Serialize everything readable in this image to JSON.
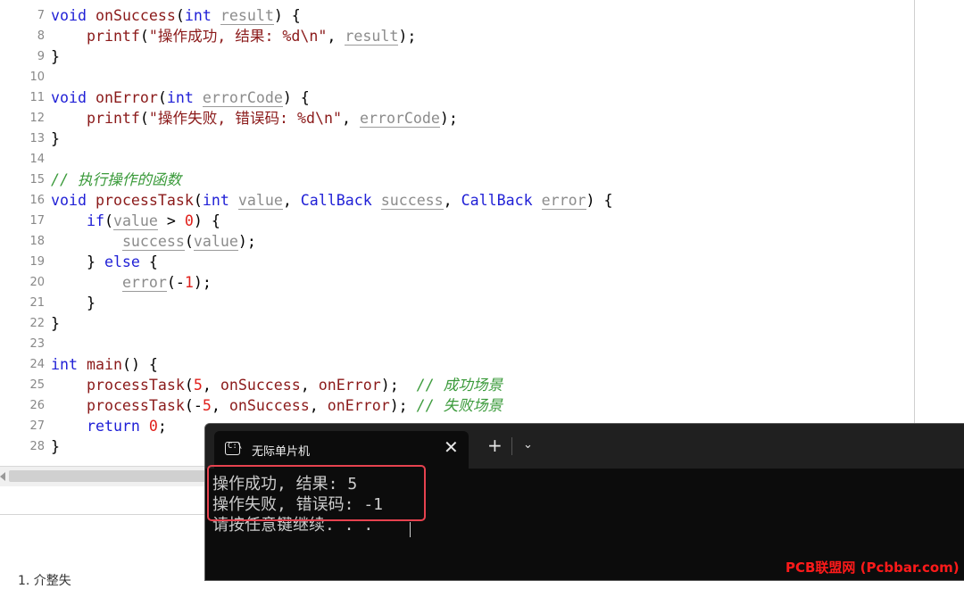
{
  "editor": {
    "lines": [
      {
        "n": "7",
        "tokens": [
          {
            "t": "void",
            "c": "kw"
          },
          {
            "t": " "
          },
          {
            "t": "onSuccess",
            "c": "fn"
          },
          {
            "t": "("
          },
          {
            "t": "int",
            "c": "kw"
          },
          {
            "t": " "
          },
          {
            "t": "result",
            "c": "param"
          },
          {
            "t": ") {"
          }
        ]
      },
      {
        "n": "8",
        "tokens": [
          {
            "t": "    "
          },
          {
            "t": "printf",
            "c": "fn"
          },
          {
            "t": "("
          },
          {
            "t": "\"操作成功, 结果: %d\\n\"",
            "c": "str"
          },
          {
            "t": ", "
          },
          {
            "t": "result",
            "c": "param"
          },
          {
            "t": ");"
          }
        ]
      },
      {
        "n": "9",
        "tokens": [
          {
            "t": "}"
          }
        ]
      },
      {
        "n": "10",
        "tokens": []
      },
      {
        "n": "11",
        "tokens": [
          {
            "t": "void",
            "c": "kw"
          },
          {
            "t": " "
          },
          {
            "t": "onError",
            "c": "fn"
          },
          {
            "t": "("
          },
          {
            "t": "int",
            "c": "kw"
          },
          {
            "t": " "
          },
          {
            "t": "errorCode",
            "c": "param"
          },
          {
            "t": ") {"
          }
        ]
      },
      {
        "n": "12",
        "tokens": [
          {
            "t": "    "
          },
          {
            "t": "printf",
            "c": "fn"
          },
          {
            "t": "("
          },
          {
            "t": "\"操作失败, 错误码: %d\\n\"",
            "c": "str"
          },
          {
            "t": ", "
          },
          {
            "t": "errorCode",
            "c": "param"
          },
          {
            "t": ");"
          }
        ]
      },
      {
        "n": "13",
        "tokens": [
          {
            "t": "}"
          }
        ]
      },
      {
        "n": "14",
        "tokens": []
      },
      {
        "n": "15",
        "tokens": [
          {
            "t": "// 执行操作的函数",
            "c": "cm"
          }
        ]
      },
      {
        "n": "16",
        "tokens": [
          {
            "t": "void",
            "c": "kw"
          },
          {
            "t": " "
          },
          {
            "t": "processTask",
            "c": "fn"
          },
          {
            "t": "("
          },
          {
            "t": "int",
            "c": "kw"
          },
          {
            "t": " "
          },
          {
            "t": "value",
            "c": "param"
          },
          {
            "t": ", "
          },
          {
            "t": "CallBack",
            "c": "ty"
          },
          {
            "t": " "
          },
          {
            "t": "success",
            "c": "param"
          },
          {
            "t": ", "
          },
          {
            "t": "CallBack",
            "c": "ty"
          },
          {
            "t": " "
          },
          {
            "t": "error",
            "c": "param"
          },
          {
            "t": ") {"
          }
        ]
      },
      {
        "n": "17",
        "tokens": [
          {
            "t": "    "
          },
          {
            "t": "if",
            "c": "kw"
          },
          {
            "t": "("
          },
          {
            "t": "value",
            "c": "param"
          },
          {
            "t": " > "
          },
          {
            "t": "0",
            "c": "num"
          },
          {
            "t": ") {"
          }
        ]
      },
      {
        "n": "18",
        "tokens": [
          {
            "t": "        "
          },
          {
            "t": "success",
            "c": "param"
          },
          {
            "t": "("
          },
          {
            "t": "value",
            "c": "param"
          },
          {
            "t": ");"
          }
        ]
      },
      {
        "n": "19",
        "tokens": [
          {
            "t": "    } "
          },
          {
            "t": "else",
            "c": "kw"
          },
          {
            "t": " {"
          }
        ]
      },
      {
        "n": "20",
        "tokens": [
          {
            "t": "        "
          },
          {
            "t": "error",
            "c": "param"
          },
          {
            "t": "(-"
          },
          {
            "t": "1",
            "c": "num"
          },
          {
            "t": ");"
          }
        ]
      },
      {
        "n": "21",
        "tokens": [
          {
            "t": "    }"
          }
        ]
      },
      {
        "n": "22",
        "tokens": [
          {
            "t": "}"
          }
        ]
      },
      {
        "n": "23",
        "tokens": []
      },
      {
        "n": "24",
        "tokens": [
          {
            "t": "int",
            "c": "kw"
          },
          {
            "t": " "
          },
          {
            "t": "main",
            "c": "fn"
          },
          {
            "t": "() {"
          }
        ]
      },
      {
        "n": "25",
        "tokens": [
          {
            "t": "    "
          },
          {
            "t": "processTask",
            "c": "fn"
          },
          {
            "t": "("
          },
          {
            "t": "5",
            "c": "num"
          },
          {
            "t": ", "
          },
          {
            "t": "onSuccess",
            "c": "fn"
          },
          {
            "t": ", "
          },
          {
            "t": "onError",
            "c": "fn"
          },
          {
            "t": ");  "
          },
          {
            "t": "// 成功场景",
            "c": "cm"
          }
        ]
      },
      {
        "n": "26",
        "tokens": [
          {
            "t": "    "
          },
          {
            "t": "processTask",
            "c": "fn"
          },
          {
            "t": "(-"
          },
          {
            "t": "5",
            "c": "num"
          },
          {
            "t": ", "
          },
          {
            "t": "onSuccess",
            "c": "fn"
          },
          {
            "t": ", "
          },
          {
            "t": "onError",
            "c": "fn"
          },
          {
            "t": "); "
          },
          {
            "t": "// 失败场景",
            "c": "cm"
          }
        ]
      },
      {
        "n": "27",
        "tokens": [
          {
            "t": "    "
          },
          {
            "t": "return",
            "c": "kw"
          },
          {
            "t": " "
          },
          {
            "t": "0",
            "c": "num"
          },
          {
            "t": ";"
          }
        ]
      },
      {
        "n": "28",
        "tokens": [
          {
            "t": "}"
          }
        ]
      }
    ]
  },
  "bottom_panel": {
    "heading": "1. 介整失"
  },
  "terminal": {
    "tab_title": "无际单片机",
    "tab_icon": "terminal-icon",
    "close_glyph": "✕",
    "new_tab_glyph": "+",
    "dropdown_glyph": "⌄",
    "output": [
      "操作成功, 结果: 5",
      "操作失败, 错误码: -1",
      "请按任意键继续. . ."
    ],
    "highlight_color": "#e6424f"
  },
  "watermark": "PCB联盟网 (Pcbbar.com)"
}
